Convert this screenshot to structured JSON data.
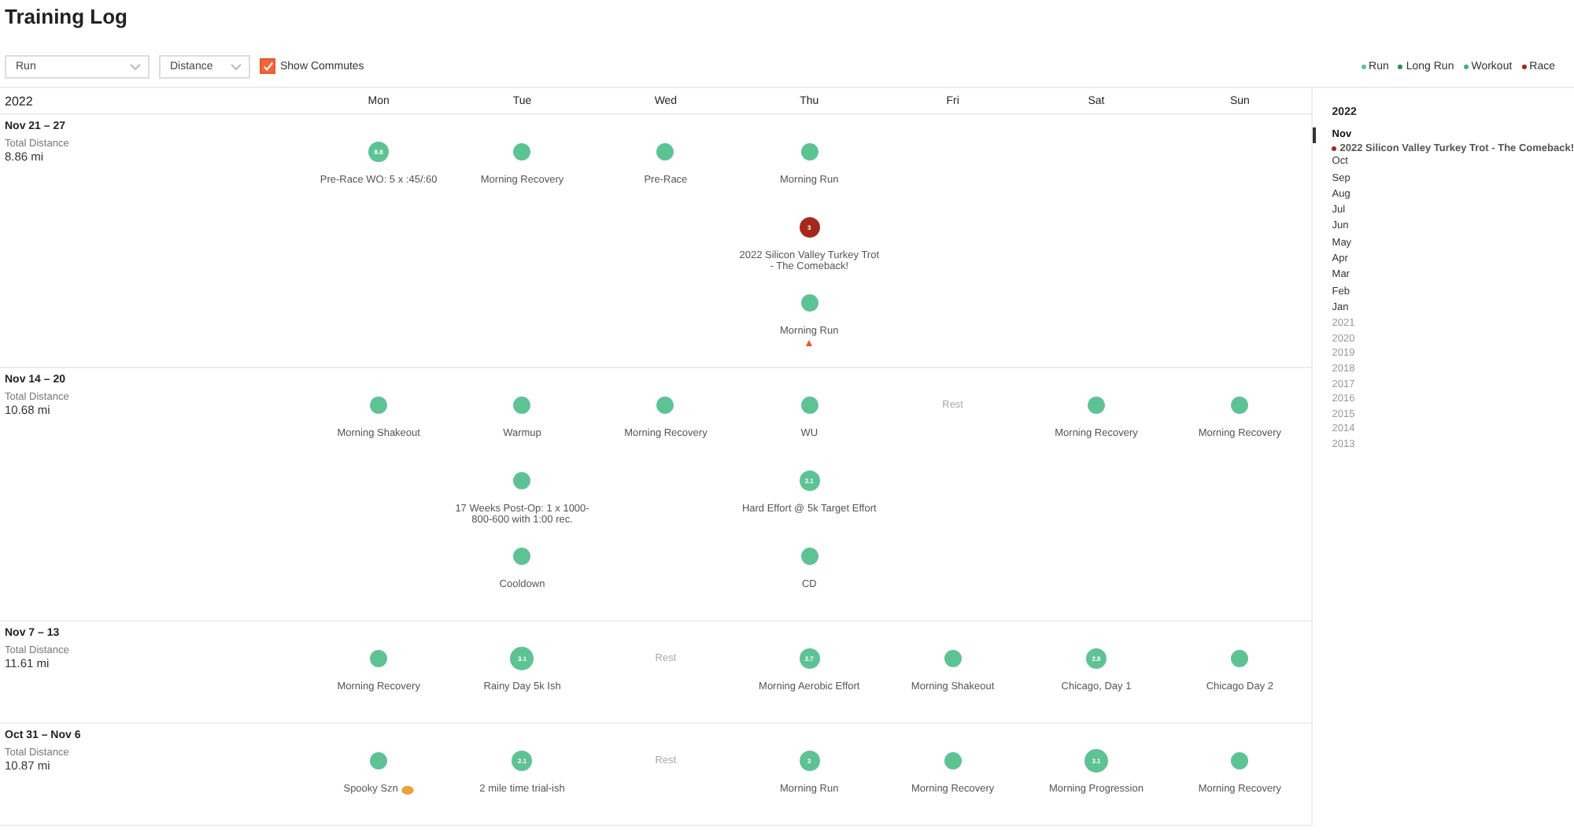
{
  "title": "Training Log",
  "filters": {
    "sport": "Run",
    "metric": "Distance",
    "commutes": {
      "label": "Show Commutes",
      "checked": true
    }
  },
  "legend": [
    {
      "label": "Run",
      "color": "#5ec394"
    },
    {
      "label": "Long Run",
      "color": "#2e8a5e"
    },
    {
      "label": "Workout",
      "color": "#44b07e"
    },
    {
      "label": "Race",
      "color": "#a5281c"
    }
  ],
  "calendar": {
    "year": "2022",
    "days": [
      "Mon",
      "Tue",
      "Wed",
      "Thu",
      "Fri",
      "Sat",
      "Sun"
    ],
    "weeks": [
      {
        "range": "Nov 21 – 27",
        "total_label": "Total Distance",
        "total": "8.86 mi",
        "days": [
          {
            "kind": "activities",
            "activities": [
              {
                "name": "Pre-Race WO: 5 x :45/:60",
                "value": "8.8",
                "color": "#5ec394"
              }
            ]
          },
          {
            "kind": "activities",
            "activities": [
              {
                "name": "Morning Recovery",
                "color": "#5ec394"
              }
            ]
          },
          {
            "kind": "activities",
            "activities": [
              {
                "name": "Pre-Race",
                "color": "#5ec394"
              }
            ]
          },
          {
            "kind": "activities",
            "activities": [
              {
                "name": "Morning Run",
                "color": "#5ec394"
              },
              {
                "name": "2022 Silicon Valley Turkey Trot - The Comeback!",
                "value": "3",
                "color": "#a5281c"
              },
              {
                "name": "Morning Run",
                "color": "#5ec394",
                "marker": true
              }
            ]
          },
          {
            "kind": "empty"
          },
          {
            "kind": "empty"
          },
          {
            "kind": "empty"
          }
        ]
      },
      {
        "range": "Nov 14 – 20",
        "total_label": "Total Distance",
        "total": "10.68 mi",
        "days": [
          {
            "kind": "activities",
            "activities": [
              {
                "name": "Morning Shakeout",
                "color": "#5ec394"
              }
            ]
          },
          {
            "kind": "activities",
            "activities": [
              {
                "name": "Warmup",
                "color": "#5ec394"
              },
              {
                "name": "17 Weeks Post-Op: 1 x 1000-800-600 with 1:00 rec.",
                "color": "#5ec394"
              },
              {
                "name": "Cooldown",
                "color": "#5ec394"
              }
            ]
          },
          {
            "kind": "activities",
            "activities": [
              {
                "name": "Morning Recovery",
                "color": "#5ec394"
              }
            ]
          },
          {
            "kind": "activities",
            "activities": [
              {
                "name": "WU",
                "color": "#5ec394"
              },
              {
                "name": "Hard Effort @ 5k Target Effort",
                "value": "2.1",
                "color": "#5ec394"
              },
              {
                "name": "CD",
                "color": "#5ec394"
              }
            ]
          },
          {
            "kind": "rest",
            "label": "Rest"
          },
          {
            "kind": "activities",
            "activities": [
              {
                "name": "Morning Recovery",
                "color": "#5ec394"
              }
            ]
          },
          {
            "kind": "activities",
            "activities": [
              {
                "name": "Morning Recovery",
                "color": "#5ec394"
              }
            ]
          }
        ]
      },
      {
        "range": "Nov 7 – 13",
        "total_label": "Total Distance",
        "total": "11.61 mi",
        "days": [
          {
            "kind": "activities",
            "activities": [
              {
                "name": "Morning Recovery",
                "color": "#5ec394"
              }
            ]
          },
          {
            "kind": "activities",
            "activities": [
              {
                "name": "Rainy Day 5k Ish",
                "value": "3.1",
                "color": "#5ec394"
              }
            ]
          },
          {
            "kind": "rest",
            "label": "Rest"
          },
          {
            "kind": "activities",
            "activities": [
              {
                "name": "Morning Aerobic Effort",
                "value": "2.7",
                "color": "#5ec394"
              }
            ]
          },
          {
            "kind": "activities",
            "activities": [
              {
                "name": "Morning Shakeout",
                "color": "#5ec394"
              }
            ]
          },
          {
            "kind": "activities",
            "activities": [
              {
                "name": "Chicago, Day 1",
                "value": "2.8",
                "color": "#5ec394"
              }
            ]
          },
          {
            "kind": "activities",
            "activities": [
              {
                "name": "Chicago Day 2",
                "color": "#5ec394"
              }
            ]
          }
        ]
      },
      {
        "range": "Oct 31 – Nov 6",
        "total_label": "Total Distance",
        "total": "10.87 mi",
        "days": [
          {
            "kind": "activities",
            "activities": [
              {
                "name": "Spooky Szn",
                "color": "#5ec394",
                "pumpkin": true
              }
            ]
          },
          {
            "kind": "activities",
            "activities": [
              {
                "name": "2 mile time trial-ish",
                "value": "2.1",
                "color": "#5ec394"
              }
            ]
          },
          {
            "kind": "rest",
            "label": "Rest"
          },
          {
            "kind": "activities",
            "activities": [
              {
                "name": "Morning Run",
                "value": "2",
                "color": "#5ec394"
              }
            ]
          },
          {
            "kind": "activities",
            "activities": [
              {
                "name": "Morning Recovery",
                "color": "#5ec394"
              }
            ]
          },
          {
            "kind": "activities",
            "activities": [
              {
                "name": "Morning Progression",
                "value": "3.1",
                "color": "#5ec394"
              }
            ]
          },
          {
            "kind": "activities",
            "activities": [
              {
                "name": "Morning Recovery",
                "color": "#5ec394"
              }
            ]
          }
        ]
      }
    ]
  },
  "sidebar": {
    "year": "2022",
    "months": [
      {
        "label": "Nov",
        "selected": true,
        "races": [
          {
            "name": "2022 Silicon Valley Turkey Trot - The Comeback!",
            "color": "#a5281c"
          }
        ]
      },
      {
        "label": "Oct",
        "selected": false
      },
      {
        "label": "Sep",
        "selected": false
      },
      {
        "label": "Aug",
        "selected": false
      },
      {
        "label": "Jul",
        "selected": false
      },
      {
        "label": "Jun",
        "selected": false
      },
      {
        "label": "May",
        "selected": false
      },
      {
        "label": "Apr",
        "selected": false
      },
      {
        "label": "Mar",
        "selected": false
      },
      {
        "label": "Feb",
        "selected": false
      },
      {
        "label": "Jan",
        "selected": false
      }
    ],
    "years": [
      "2021",
      "2020",
      "2019",
      "2018",
      "2017",
      "2016",
      "2015",
      "2014",
      "2013"
    ]
  }
}
